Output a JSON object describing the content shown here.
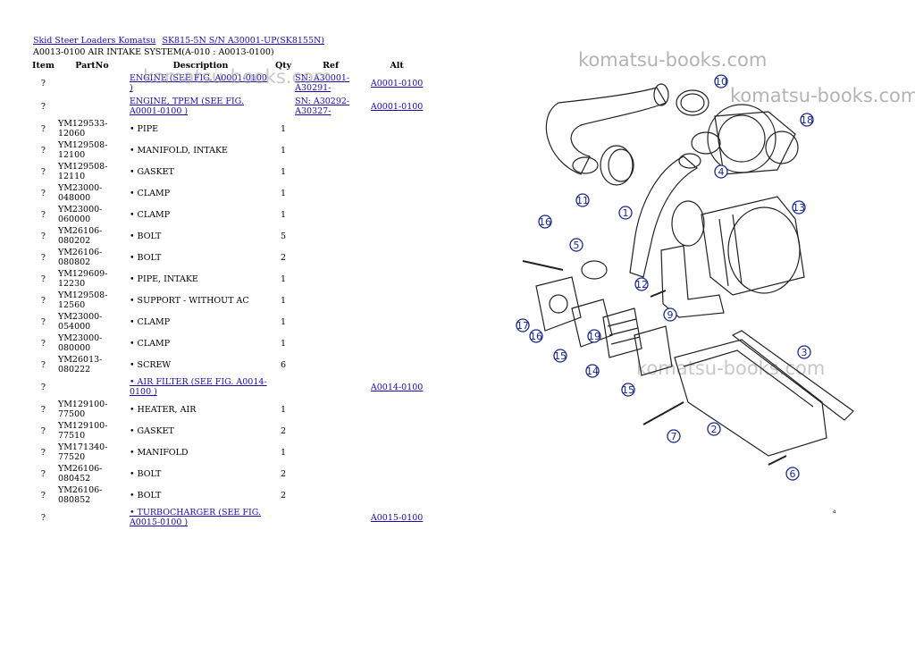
{
  "breadcrumb": {
    "links": [
      "Skid Steer Loaders Komatsu",
      "SK815-5N S/N A30001-UP(SK8155N)"
    ]
  },
  "page_title": "A0013-0100 AIR INTAKE SYSTEM(A-010 : A0013-0100)",
  "table": {
    "headers": {
      "item": "Item",
      "partno": "PartNo",
      "description": "Description",
      "qty": "Qty",
      "ref": "Ref",
      "alt": "Alt"
    },
    "rows": [
      {
        "item": "?",
        "partno": "",
        "desc": "ENGINE (SEE FIG. A0001-0100 )",
        "qty": "",
        "ref": "SN: A30001-A30291-",
        "alt": "A0001-0100"
      },
      {
        "item": "?",
        "partno": "",
        "desc": "ENGINE, TPEM (SEE FIG. A0001-0100 )",
        "qty": "",
        "ref": "SN: A30292-A30327-",
        "alt": "A0001-0100"
      },
      {
        "item": "?",
        "partno": "YM129533-12060",
        "desc": "• PIPE",
        "qty": "1",
        "ref": "",
        "alt": ""
      },
      {
        "item": "?",
        "partno": "YM129508-12100",
        "desc": "• MANIFOLD, INTAKE",
        "qty": "1",
        "ref": "",
        "alt": ""
      },
      {
        "item": "?",
        "partno": "YM129508-12110",
        "desc": "• GASKET",
        "qty": "1",
        "ref": "",
        "alt": ""
      },
      {
        "item": "?",
        "partno": "YM23000-048000",
        "desc": "• CLAMP",
        "qty": "1",
        "ref": "",
        "alt": ""
      },
      {
        "item": "?",
        "partno": "YM23000-060000",
        "desc": "• CLAMP",
        "qty": "1",
        "ref": "",
        "alt": ""
      },
      {
        "item": "?",
        "partno": "YM26106-080202",
        "desc": "• BOLT",
        "qty": "5",
        "ref": "",
        "alt": ""
      },
      {
        "item": "?",
        "partno": "YM26106-080802",
        "desc": "• BOLT",
        "qty": "2",
        "ref": "",
        "alt": ""
      },
      {
        "item": "?",
        "partno": "YM129609-12230",
        "desc": "• PIPE, INTAKE",
        "qty": "1",
        "ref": "",
        "alt": ""
      },
      {
        "item": "?",
        "partno": "YM129508-12560",
        "desc": "• SUPPORT - WITHOUT AC",
        "qty": "1",
        "ref": "",
        "alt": ""
      },
      {
        "item": "?",
        "partno": "YM23000-054000",
        "desc": "• CLAMP",
        "qty": "1",
        "ref": "",
        "alt": ""
      },
      {
        "item": "?",
        "partno": "YM23000-080000",
        "desc": "• CLAMP",
        "qty": "1",
        "ref": "",
        "alt": ""
      },
      {
        "item": "?",
        "partno": "YM26013-080222",
        "desc": "• SCREW",
        "qty": "6",
        "ref": "",
        "alt": ""
      },
      {
        "item": "?",
        "partno": "",
        "desc": "• AIR FILTER (SEE FIG. A0014-0100 )",
        "qty": "",
        "ref": "",
        "alt": "A0014-0100"
      },
      {
        "item": "?",
        "partno": "YM129100-77500",
        "desc": "• HEATER, AIR",
        "qty": "1",
        "ref": "",
        "alt": ""
      },
      {
        "item": "?",
        "partno": "YM129100-77510",
        "desc": "• GASKET",
        "qty": "2",
        "ref": "",
        "alt": ""
      },
      {
        "item": "?",
        "partno": "YM171340-77520",
        "desc": "• MANIFOLD",
        "qty": "1",
        "ref": "",
        "alt": ""
      },
      {
        "item": "?",
        "partno": "YM26106-080452",
        "desc": "• BOLT",
        "qty": "2",
        "ref": "",
        "alt": ""
      },
      {
        "item": "?",
        "partno": "YM26106-080852",
        "desc": "• BOLT",
        "qty": "2",
        "ref": "",
        "alt": ""
      },
      {
        "item": "?",
        "partno": "",
        "desc": "• TURBOCHARGER (SEE FIG. A0015-0100 )",
        "qty": "",
        "ref": "",
        "alt": "A0015-0100"
      }
    ]
  },
  "watermarks": [
    "komatsu-books.com",
    "komatsu-books.com",
    "komatsu-books.com",
    "komatsu-books.com"
  ],
  "diagram": {
    "callouts": [
      "1",
      "2",
      "3",
      "4",
      "5",
      "6",
      "7",
      "9",
      "10",
      "11",
      "12",
      "13",
      "14",
      "15",
      "15",
      "16",
      "16",
      "17",
      "18",
      "19"
    ]
  },
  "corner_mark": "a",
  "colors": {
    "link": "#1a0dab",
    "callout": "#1b2a8a",
    "watermark": "#9a9a9a"
  }
}
